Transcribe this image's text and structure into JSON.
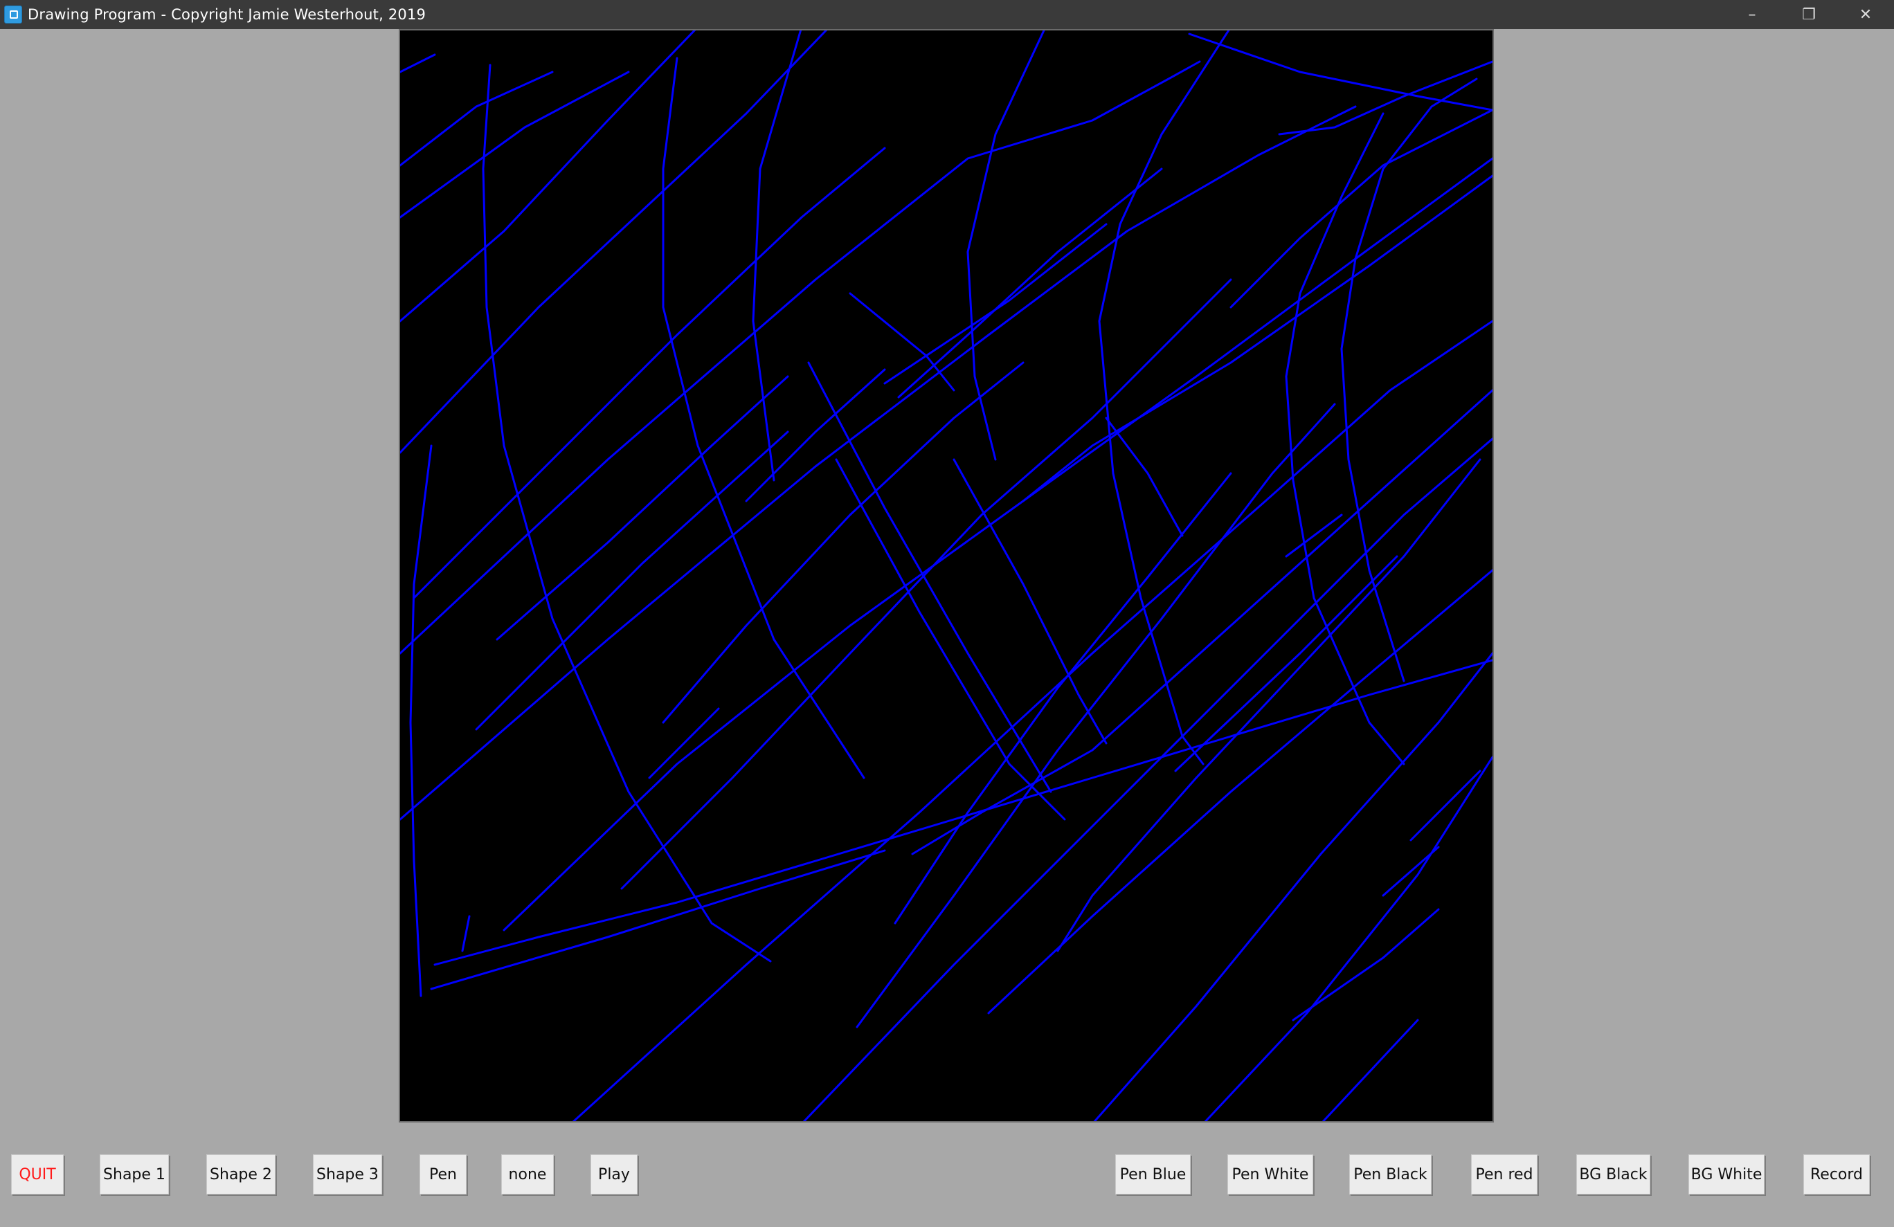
{
  "window": {
    "title": "Drawing Program - Copyright Jamie Westerhout, 2019",
    "icon": "app-icon",
    "controls": {
      "minimize": "–",
      "maximize": "❐",
      "close": "✕"
    }
  },
  "canvas": {
    "background": "#000000",
    "stroke_color": "#0000ff"
  },
  "toolbar": {
    "left_buttons": [
      {
        "label": "QUIT",
        "color": "#ff1a1a"
      },
      {
        "label": "Shape 1"
      },
      {
        "label": "Shape 2"
      },
      {
        "label": "Shape 3"
      },
      {
        "label": "Pen"
      },
      {
        "label": "none"
      },
      {
        "label": "Play"
      }
    ],
    "right_buttons": [
      {
        "label": "Pen Blue"
      },
      {
        "label": "Pen White"
      },
      {
        "label": "Pen Black"
      },
      {
        "label": "Pen red"
      },
      {
        "label": "BG Black"
      },
      {
        "label": "BG White"
      },
      {
        "label": "Record"
      }
    ]
  }
}
